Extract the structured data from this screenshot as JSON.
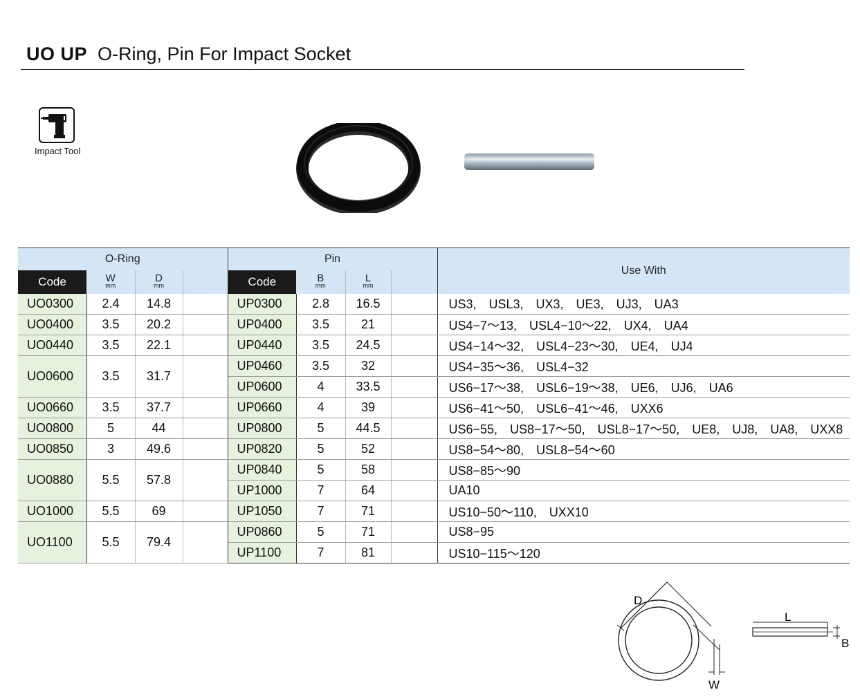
{
  "title": {
    "codes": "UO  UP",
    "name": "O-Ring, Pin For Impact Socket"
  },
  "badge": {
    "icon": "impact-tool-icon",
    "label": "Impact Tool"
  },
  "table": {
    "oring_group": "O-Ring",
    "pin_group": "Pin",
    "use_with_header": "Use With",
    "headers": {
      "code": "Code",
      "w": "W",
      "d": "D",
      "b": "B",
      "l": "L",
      "unit": "mm"
    },
    "rows": [
      {
        "oring": {
          "code": "UO0300",
          "w": "2.4",
          "d": "14.8",
          "span": 1
        },
        "pin": {
          "code": "UP0300",
          "b": "2.8",
          "l": "16.5"
        },
        "use": "US3,　USL3,　UX3,　UE3,　UJ3,　UA3"
      },
      {
        "oring": {
          "code": "UO0400",
          "w": "3.5",
          "d": "20.2",
          "span": 1
        },
        "pin": {
          "code": "UP0400",
          "b": "3.5",
          "l": "21"
        },
        "use": "US4−7～13,　USL4−10～22,　UX4,　UA4"
      },
      {
        "oring": {
          "code": "UO0440",
          "w": "3.5",
          "d": "22.1",
          "span": 1
        },
        "pin": {
          "code": "UP0440",
          "b": "3.5",
          "l": "24.5"
        },
        "use": "US4−14～32,　USL4−23～30,　UE4,　UJ4"
      },
      {
        "oring": {
          "code": "UO0600",
          "w": "3.5",
          "d": "31.7",
          "span": 2
        },
        "pin": {
          "code": "UP0460",
          "b": "3.5",
          "l": "32"
        },
        "use": "US4−35～36,　USL4−32"
      },
      {
        "oring": null,
        "pin": {
          "code": "UP0600",
          "b": "4",
          "l": "33.5"
        },
        "use": "US6−17～38,　USL6−19～38,　UE6,　UJ6,　UA6"
      },
      {
        "oring": {
          "code": "UO0660",
          "w": "3.5",
          "d": "37.7",
          "span": 1
        },
        "pin": {
          "code": "UP0660",
          "b": "4",
          "l": "39"
        },
        "use": "US6−41～50,　USL6−41～46,　UXX6"
      },
      {
        "oring": {
          "code": "UO0800",
          "w": "5",
          "d": "44",
          "span": 1
        },
        "pin": {
          "code": "UP0800",
          "b": "5",
          "l": "44.5"
        },
        "use": "US6−55,　US8−17～50,　USL8−17～50,　UE8,　UJ8,　UA8,　UXX8"
      },
      {
        "oring": {
          "code": "UO0850",
          "w": "3",
          "d": "49.6",
          "span": 1
        },
        "pin": {
          "code": "UP0820",
          "b": "5",
          "l": "52"
        },
        "use": "US8−54～80,　USL8−54～60"
      },
      {
        "oring": {
          "code": "UO0880",
          "w": "5.5",
          "d": "57.8",
          "span": 2
        },
        "pin": {
          "code": "UP0840",
          "b": "5",
          "l": "58"
        },
        "use": "US8−85～90"
      },
      {
        "oring": null,
        "pin": {
          "code": "UP1000",
          "b": "7",
          "l": "64"
        },
        "use": "UA10"
      },
      {
        "oring": {
          "code": "UO1000",
          "w": "5.5",
          "d": "69",
          "span": 1
        },
        "pin": {
          "code": "UP1050",
          "b": "7",
          "l": "71"
        },
        "use": "US10−50～110,　UXX10"
      },
      {
        "oring": {
          "code": "UO1100",
          "w": "5.5",
          "d": "79.4",
          "span": 2
        },
        "pin": {
          "code": "UP0860",
          "b": "5",
          "l": "71"
        },
        "use": "US8−95"
      },
      {
        "oring": null,
        "pin": {
          "code": "UP1100",
          "b": "7",
          "l": "81"
        },
        "use": "US10−115～120"
      }
    ]
  },
  "diagram": {
    "oring_labels": {
      "d": "D",
      "w": "W"
    },
    "pin_labels": {
      "l": "L",
      "b": "B"
    }
  }
}
